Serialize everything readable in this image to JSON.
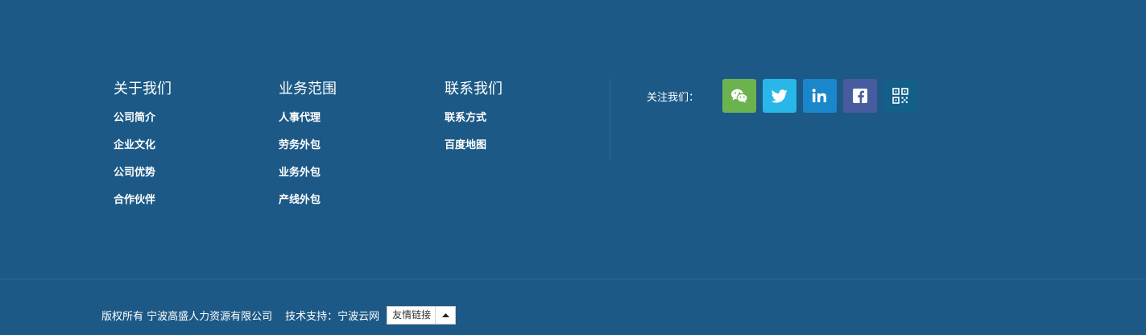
{
  "nav": {
    "about": {
      "title": "关于我们",
      "items": [
        "公司简介",
        "企业文化",
        "公司优势",
        "合作伙伴"
      ]
    },
    "business": {
      "title": "业务范围",
      "items": [
        "人事代理",
        "劳务外包",
        "业务外包",
        "产线外包"
      ]
    },
    "contact": {
      "title": "联系我们",
      "items": [
        "联系方式",
        "百度地图"
      ]
    }
  },
  "follow": {
    "label": "关注我们：",
    "buttons": [
      {
        "icon": "wechat-icon",
        "color": "#6bb34f"
      },
      {
        "icon": "twitter-icon",
        "color": "#28b7e8"
      },
      {
        "icon": "linkedin-icon",
        "color": "#1a87cb"
      },
      {
        "icon": "facebook-icon",
        "color": "#465c9e"
      },
      {
        "icon": "qrcode-icon",
        "color": "#125f8a"
      }
    ]
  },
  "bottom": {
    "copyright": "版权所有 宁波高盛人力资源有限公司",
    "support": "技术支持：宁波云网",
    "links_label": "友情链接"
  },
  "colors": {
    "background": "#1c5986",
    "divider": "#2d6890"
  }
}
